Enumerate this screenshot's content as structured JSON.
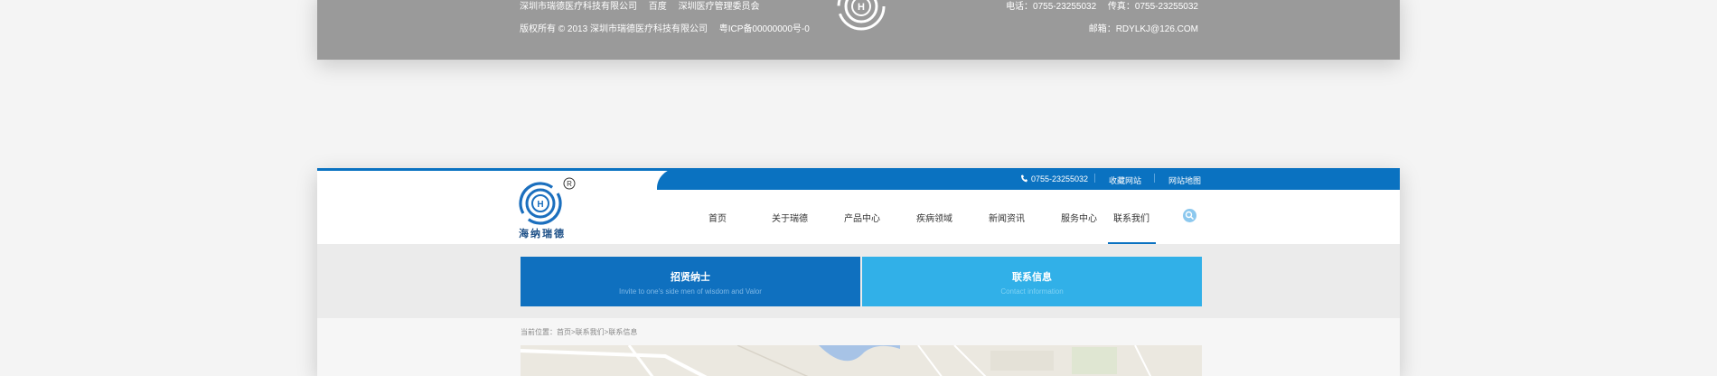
{
  "footer": {
    "links": [
      "深圳市瑞德医疗科技有限公司",
      "百度",
      "深圳医疗管理委员会"
    ],
    "copyright": "版权所有 © 2013 深圳市瑞德医疗科技有限公司",
    "icp": "粤ICP备00000000号-0",
    "phone": "电话：0755-23255032",
    "fax": "传真：0755-23255032",
    "email": "邮箱：RDYLKJ@126.COM"
  },
  "topbar": {
    "phone": "0755-23255032",
    "bookmark": "收藏网站",
    "sitemap": "网站地图"
  },
  "logo": {
    "name": "海纳瑞德",
    "registered_mark": "R",
    "emblem_letter": "H"
  },
  "nav": [
    "首页",
    "关于瑞德",
    "产品中心",
    "疾病领域",
    "新闻资讯",
    "服务中心",
    "联系我们"
  ],
  "nav_active": "联系我们",
  "tabs": [
    {
      "title": "招贤纳士",
      "subtitle": "Invite to one's side men of wisdom and Valor"
    },
    {
      "title": "联系信息",
      "subtitle": "Contact information"
    }
  ],
  "breadcrumb": "当前位置：首页>联系我们>联系信息",
  "colors": {
    "primary": "#0a72c1",
    "accent": "#31b0e8",
    "footer_bg": "#9a9a9a"
  },
  "icons": [
    "phone-icon",
    "search-icon",
    "logo-emblem"
  ]
}
